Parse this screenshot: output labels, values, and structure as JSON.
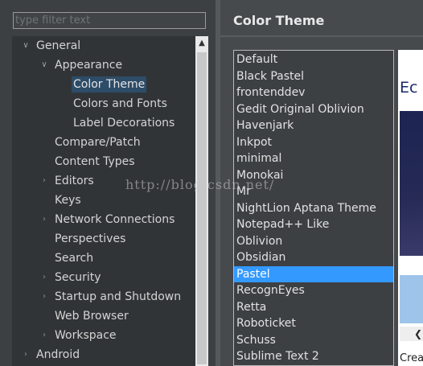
{
  "filter": {
    "placeholder": "type filter text",
    "value": ""
  },
  "tree": {
    "items": [
      {
        "label": "General",
        "depth": 0,
        "state": "open"
      },
      {
        "label": "Appearance",
        "depth": 1,
        "state": "open"
      },
      {
        "label": "Color Theme",
        "depth": 2,
        "state": "leaf",
        "selected": true
      },
      {
        "label": "Colors and Fonts",
        "depth": 2,
        "state": "leaf"
      },
      {
        "label": "Label Decorations",
        "depth": 2,
        "state": "leaf"
      },
      {
        "label": "Compare/Patch",
        "depth": 1,
        "state": "leaf"
      },
      {
        "label": "Content Types",
        "depth": 1,
        "state": "leaf"
      },
      {
        "label": "Editors",
        "depth": 1,
        "state": "closed"
      },
      {
        "label": "Keys",
        "depth": 1,
        "state": "leaf"
      },
      {
        "label": "Network Connections",
        "depth": 1,
        "state": "closed"
      },
      {
        "label": "Perspectives",
        "depth": 1,
        "state": "leaf"
      },
      {
        "label": "Search",
        "depth": 1,
        "state": "leaf"
      },
      {
        "label": "Security",
        "depth": 1,
        "state": "closed"
      },
      {
        "label": "Startup and Shutdown",
        "depth": 1,
        "state": "closed"
      },
      {
        "label": "Web Browser",
        "depth": 1,
        "state": "leaf"
      },
      {
        "label": "Workspace",
        "depth": 1,
        "state": "closed"
      },
      {
        "label": "Android",
        "depth": 0,
        "state": "closed"
      }
    ]
  },
  "page": {
    "title": "Color Theme"
  },
  "themes": {
    "selected": "Pastel",
    "items": [
      "Default",
      "Black Pastel",
      "frontenddev",
      "Gedit Original Oblivion",
      "Havenjark",
      "Inkpot",
      "minimal",
      "Monokai",
      "Mr",
      "NightLion Aptana Theme",
      "Notepad++ Like",
      "Oblivion",
      "Obsidian",
      "Pastel",
      "RecognEyes",
      "Retta",
      "Roboticket",
      "Schuss",
      "Sublime Text 2"
    ]
  },
  "preview": {
    "title_fragment": "Ec",
    "caption_fragment": "Crea",
    "scroll_arrow": "❮"
  },
  "watermark": "http://blog.csdn.net/",
  "colors": {
    "selection": "#3399ff",
    "tree_selection": "#2d4c68",
    "panel_bg": "#3d4043"
  }
}
